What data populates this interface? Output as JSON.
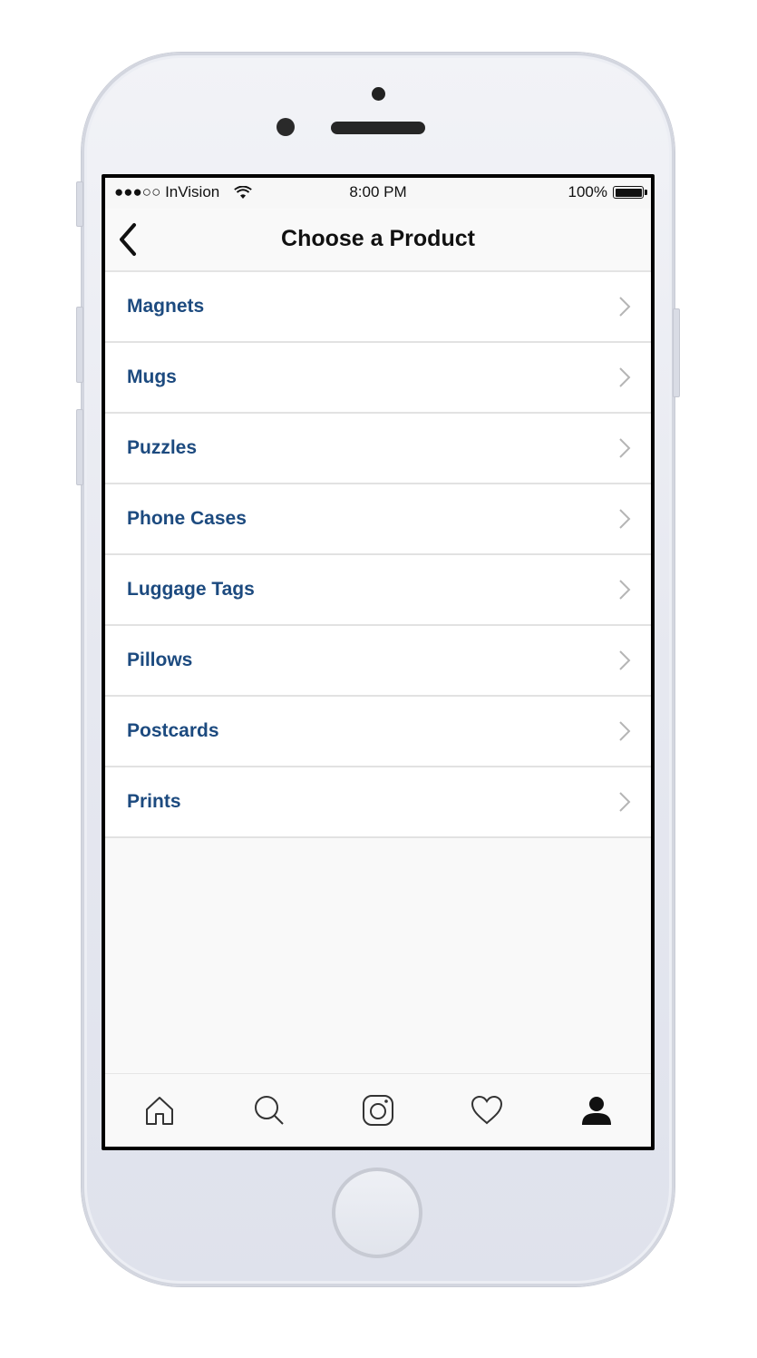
{
  "status_bar": {
    "carrier": "●●●○○ InVision",
    "time": "8:00 PM",
    "battery": "100%",
    "battery_level": 1.0
  },
  "nav": {
    "title": "Choose a Product",
    "back_icon": "chevron-left-icon"
  },
  "products": [
    {
      "label": "Magnets"
    },
    {
      "label": "Mugs"
    },
    {
      "label": "Puzzles"
    },
    {
      "label": "Phone Cases"
    },
    {
      "label": "Luggage Tags"
    },
    {
      "label": "Pillows"
    },
    {
      "label": "Postcards"
    },
    {
      "label": "Prints"
    }
  ],
  "tab_bar": {
    "tabs": [
      {
        "icon": "home-icon"
      },
      {
        "icon": "search-icon"
      },
      {
        "icon": "camera-icon"
      },
      {
        "icon": "heart-icon"
      },
      {
        "icon": "profile-icon",
        "active": true
      }
    ]
  },
  "colors": {
    "item_text": "#1c4a7f",
    "chevron": "#b5b5b5",
    "background": "#f9f9f9"
  }
}
